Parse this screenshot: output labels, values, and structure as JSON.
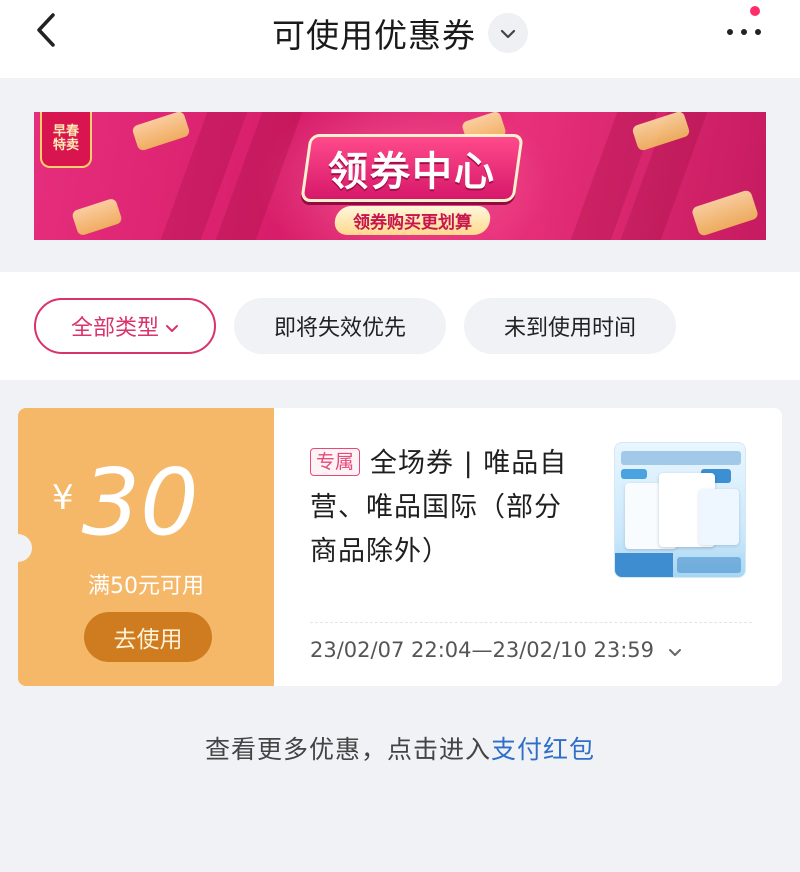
{
  "header": {
    "title": "可使用优惠券",
    "back_icon": "chevron-left-icon",
    "dropdown_icon": "chevron-down-icon",
    "more_icon": "more-dots-icon",
    "notification_color": "#ff2d6a"
  },
  "banner": {
    "corner_badge": "早春特卖",
    "title": "领券中心",
    "subtitle": "领券购买更划算",
    "colors": {
      "primary": "#d81e6a",
      "accent": "#ffd98c"
    }
  },
  "filters": {
    "items": [
      {
        "label": "全部类型",
        "active": true
      },
      {
        "label": "即将失效优先",
        "active": false
      },
      {
        "label": "未到使用时间",
        "active": false
      }
    ],
    "active_color": "#d9336b"
  },
  "coupon": {
    "currency": "¥",
    "amount": "30",
    "condition": "满50元可用",
    "use_button": "去使用",
    "tag": "专属",
    "description": "全场券 | 唯品自营、唯品国际（部分商品除外）",
    "validity": "23/02/07 22:04—23/02/10 23:59",
    "thumbnail_icon": "diaper-product-image",
    "colors": {
      "left_panel": "#f4b868",
      "button": "#cf7b1f"
    }
  },
  "footer": {
    "text": "查看更多优惠，点击进入",
    "link": "支付红包",
    "link_color": "#2e6fc9"
  }
}
